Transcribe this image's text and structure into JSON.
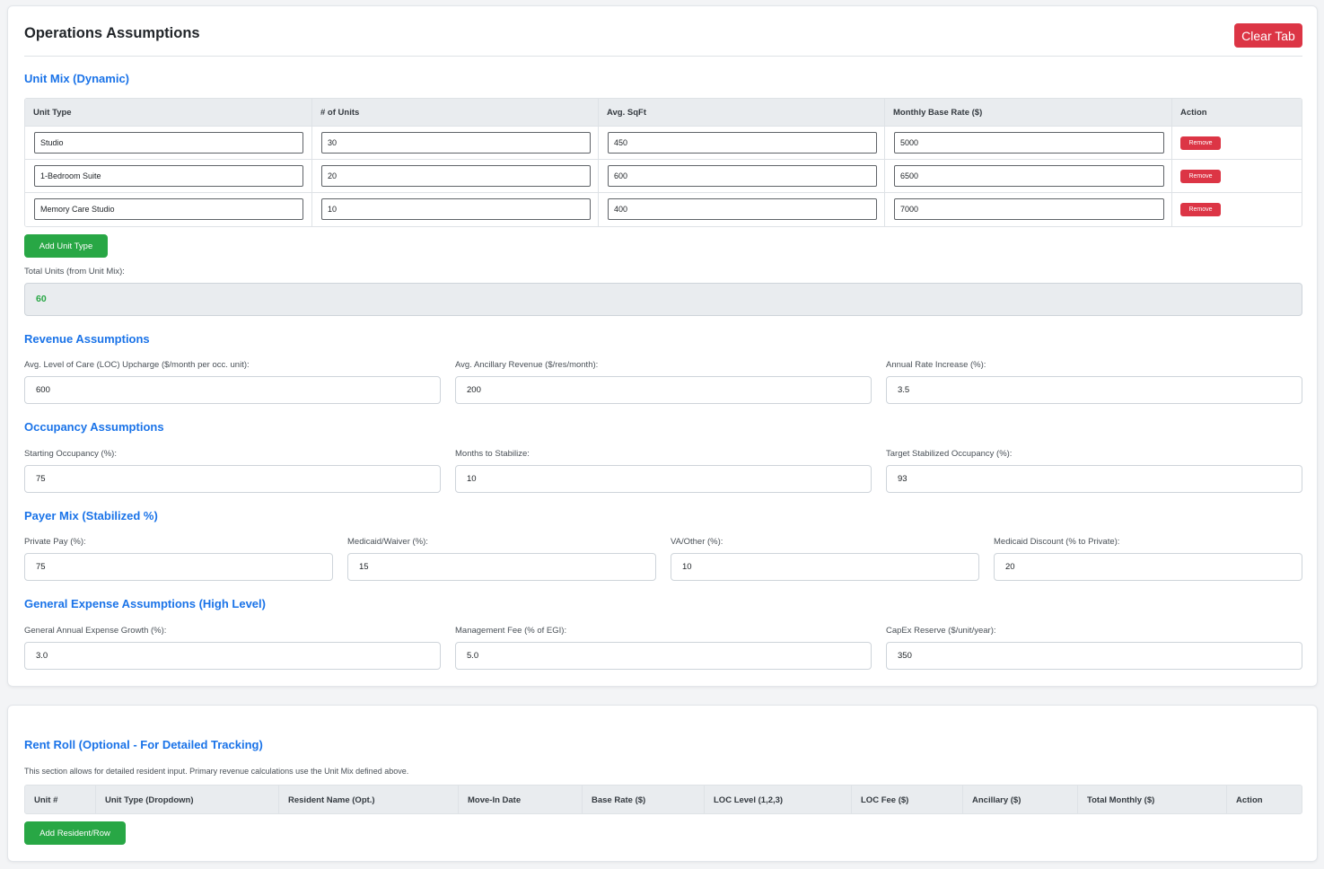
{
  "page": {
    "title": "Operations Assumptions",
    "clear_label": "Clear Tab"
  },
  "unit_mix": {
    "title": "Unit Mix (Dynamic)",
    "headers": [
      "Unit Type",
      "# of Units",
      "Avg. SqFt",
      "Monthly Base Rate ($)",
      "Action"
    ],
    "rows": [
      {
        "unit_type": "Studio",
        "units": "30",
        "sqft": "450",
        "rate": "5000",
        "action": "Remove"
      },
      {
        "unit_type": "1-Bedroom Suite",
        "units": "20",
        "sqft": "600",
        "rate": "6500",
        "action": "Remove"
      },
      {
        "unit_type": "Memory Care Studio",
        "units": "10",
        "sqft": "400",
        "rate": "7000",
        "action": "Remove"
      }
    ],
    "add_label": "Add Unit Type",
    "total_label": "Total Units (from Unit Mix):",
    "total_value": "60"
  },
  "revenue": {
    "title": "Revenue Assumptions",
    "fields": [
      {
        "label": "Avg. Level of Care (LOC) Upcharge ($/month per occ. unit):",
        "value": "600"
      },
      {
        "label": "Avg. Ancillary Revenue ($/res/month):",
        "value": "200"
      },
      {
        "label": "Annual Rate Increase (%):",
        "value": "3.5"
      }
    ]
  },
  "occupancy": {
    "title": "Occupancy Assumptions",
    "fields": [
      {
        "label": "Starting Occupancy (%):",
        "value": "75"
      },
      {
        "label": "Months to Stabilize:",
        "value": "10"
      },
      {
        "label": "Target Stabilized Occupancy (%):",
        "value": "93"
      }
    ]
  },
  "payer_mix": {
    "title": "Payer Mix (Stabilized %)",
    "fields": [
      {
        "label": "Private Pay (%):",
        "value": "75"
      },
      {
        "label": "Medicaid/Waiver (%):",
        "value": "15"
      },
      {
        "label": "VA/Other (%):",
        "value": "10"
      },
      {
        "label": "Medicaid Discount (% to Private):",
        "value": "20"
      }
    ]
  },
  "expense": {
    "title": "General Expense Assumptions (High Level)",
    "fields": [
      {
        "label": "General Annual Expense Growth (%):",
        "value": "3.0"
      },
      {
        "label": "Management Fee (% of EGI):",
        "value": "5.0"
      },
      {
        "label": "CapEx Reserve ($/unit/year):",
        "value": "350"
      }
    ]
  },
  "rent_roll": {
    "title": "Rent Roll (Optional - For Detailed Tracking)",
    "note": "This section allows for detailed resident input. Primary revenue calculations use the Unit Mix defined above.",
    "headers": [
      "Unit #",
      "Unit Type (Dropdown)",
      "Resident Name (Opt.)",
      "Move-In Date",
      "Base Rate ($)",
      "LOC Level (1,2,3)",
      "LOC Fee ($)",
      "Ancillary ($)",
      "Total Monthly ($)",
      "Action"
    ],
    "add_label": "Add Resident/Row"
  },
  "colors": {
    "accent": "#1a73e8",
    "danger": "#dc3545",
    "success": "#28a745"
  }
}
